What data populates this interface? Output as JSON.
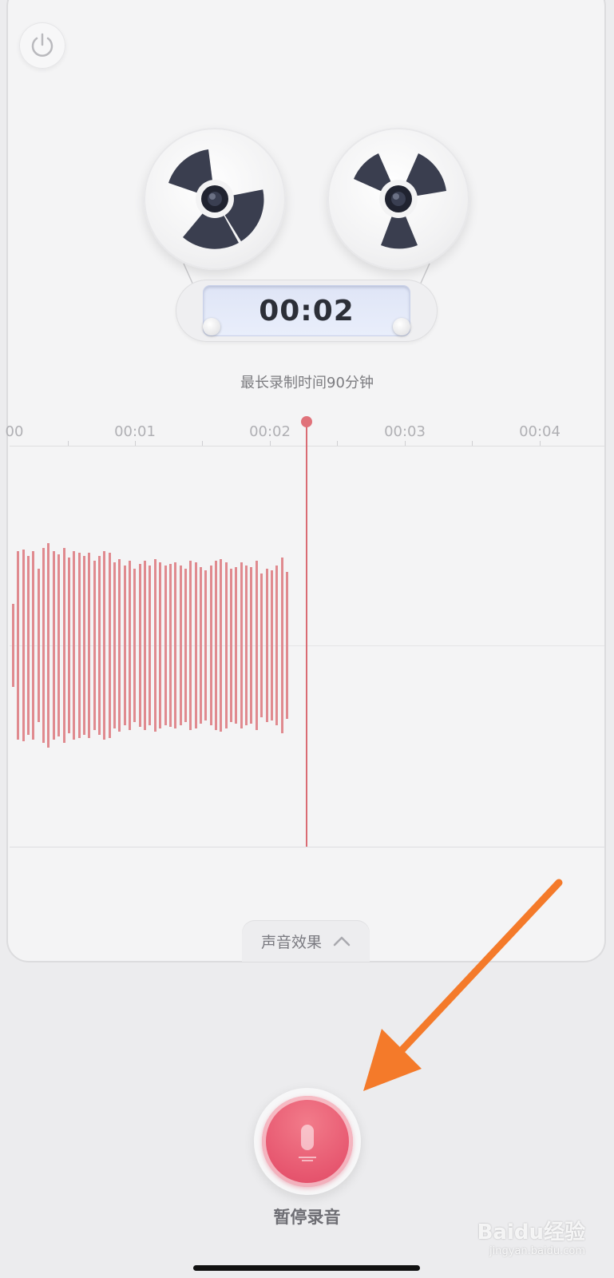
{
  "recorder": {
    "elapsed_time": "00:02",
    "max_duration_note": "最长录制时间90分钟"
  },
  "timeline": {
    "tick_labels": [
      "00",
      "00:01",
      "00:02",
      "00:03",
      "00:04"
    ]
  },
  "effects_tab": {
    "label": "声音效果"
  },
  "record_button": {
    "label": "暂停录音"
  },
  "watermark": {
    "text": "Baidu经验",
    "sub": "jingyan.baidu.com"
  },
  "colors": {
    "accent": "#e6556e",
    "waveform": "#e08a8f",
    "arrow": "#f47a2a"
  }
}
